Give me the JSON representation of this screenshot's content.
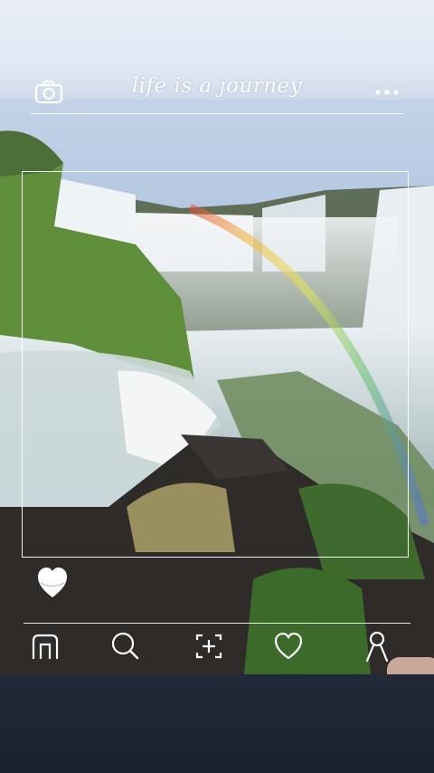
{
  "app": {
    "title": "life is a journey"
  },
  "header": {
    "camera_icon": "camera-icon",
    "more_icon": "more-dots-icon"
  },
  "fab": {
    "icon": "heart-icon"
  },
  "nav": {
    "items": [
      {
        "icon": "home-icon"
      },
      {
        "icon": "search-icon"
      },
      {
        "icon": "add-photo-icon"
      },
      {
        "icon": "heart-outline-icon"
      },
      {
        "icon": "profile-icon"
      }
    ]
  },
  "colors": {
    "overlay_text": "#ffffff",
    "sky": "#dfe7f3",
    "grass": "#5f8f3a",
    "water": "#e9f2f4",
    "dark_rock": "#2b2a2a"
  }
}
